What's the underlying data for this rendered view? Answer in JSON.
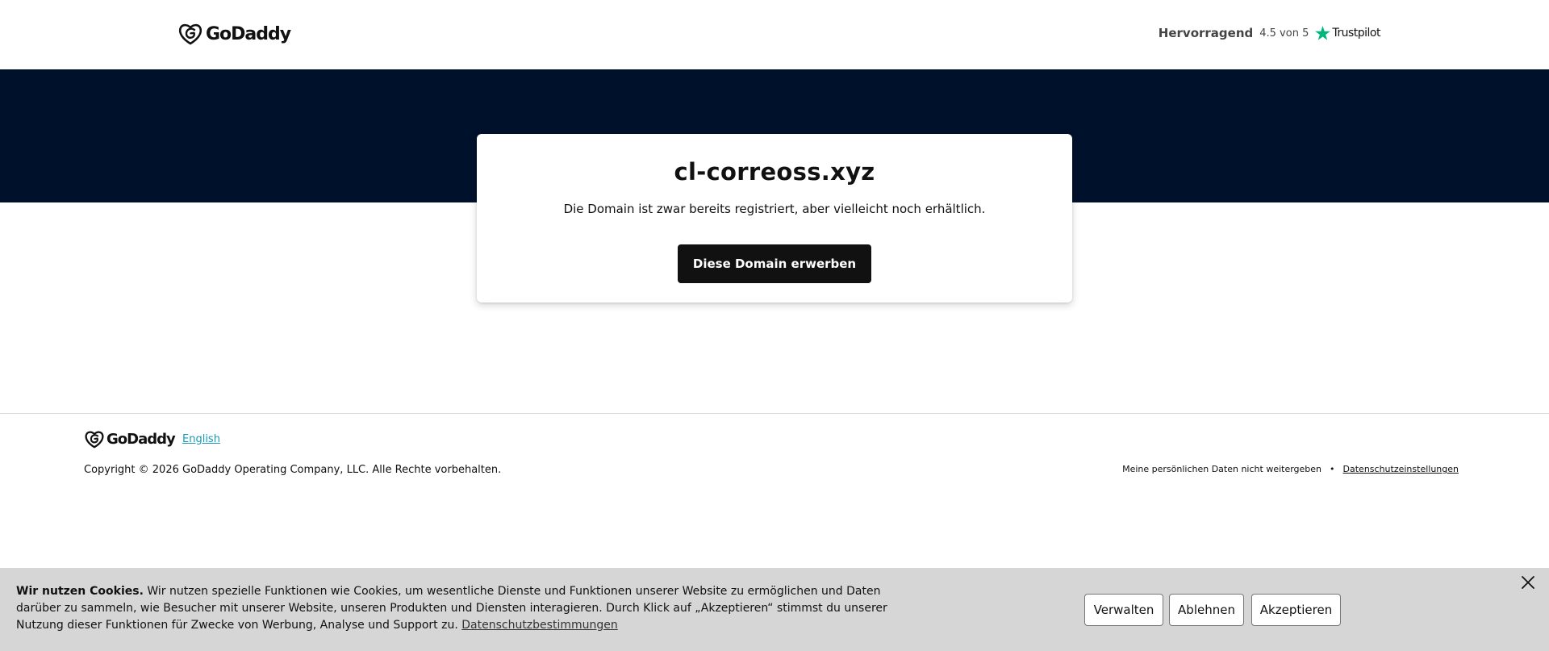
{
  "header": {
    "logo_text": "GoDaddy",
    "rating_label": "Hervorragend",
    "rating_score": "4.5 von 5",
    "trustpilot": "Trustpilot",
    "trustpilot_star_color": "#00b67a"
  },
  "main": {
    "domain": "cl-correoss.xyz",
    "note": "Die Domain ist zwar bereits registriert, aber vielleicht noch erhältlich.",
    "buy_button": "Diese Domain erwerben"
  },
  "footer": {
    "logo_text": "GoDaddy",
    "language_link": "English",
    "copyright": "Copyright © 2026 GoDaddy Operating Company, LLC. Alle Rechte vorbehalten.",
    "do_not_share": "Meine persönlichen Daten nicht weitergeben",
    "privacy_settings": "Datenschutzeinstellungen"
  },
  "cookie_banner": {
    "title": "Wir nutzen Cookies.",
    "body": " Wir nutzen spezielle Funktionen wie Cookies, um wesentliche Dienste und Funktionen unserer Website zu ermöglichen und Daten darüber zu sammeln, wie Besucher mit unserer Website, unseren Produkten und Diensten interagieren. Durch Klick auf „Akzeptieren“ stimmst du unserer Nutzung dieser Funktionen für Zwecke von Werbung, Analyse und Support zu. ",
    "privacy_link": "Datenschutzbestimmungen",
    "manage": "Verwalten",
    "decline": "Ablehnen",
    "accept": "Akzeptieren"
  },
  "colors": {
    "hero_bg": "#00112c",
    "button_bg": "#111111",
    "cookie_bg": "#d6d6d6",
    "link": "#1b99b4"
  }
}
